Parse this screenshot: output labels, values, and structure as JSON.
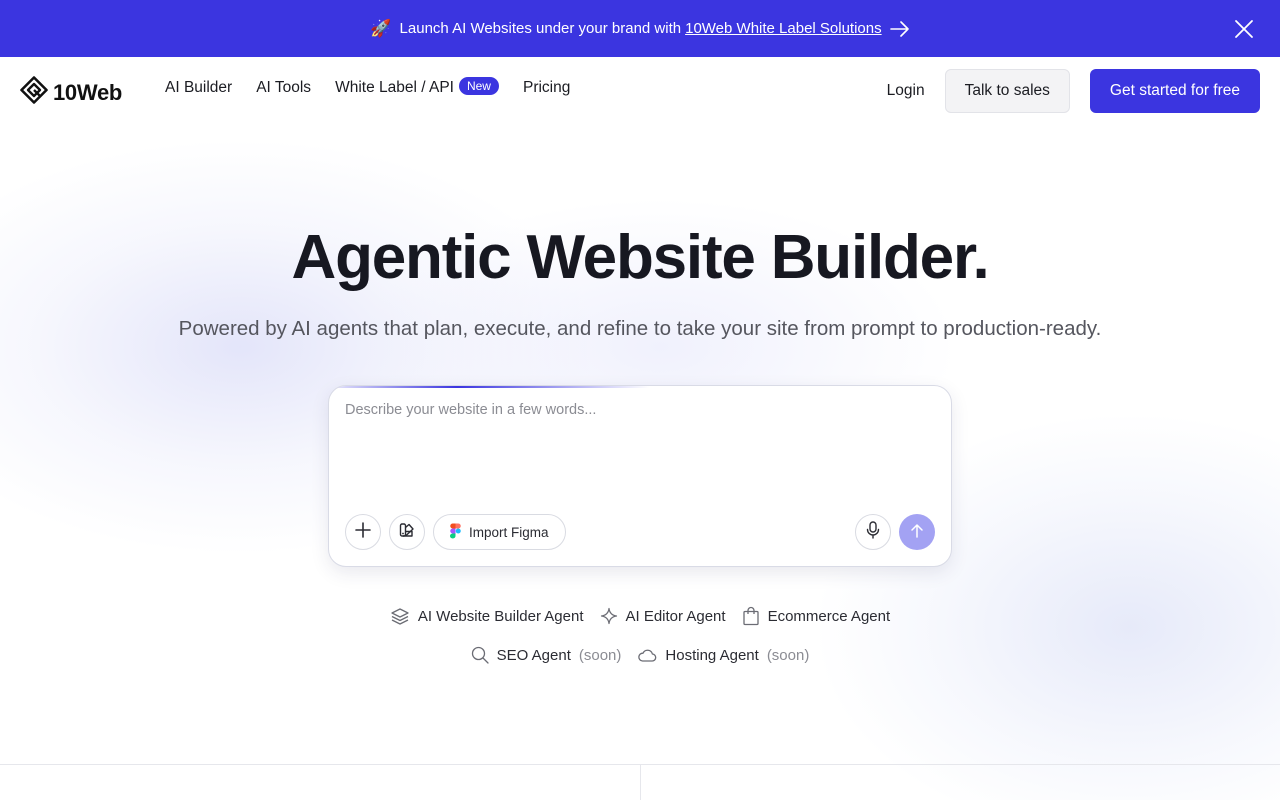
{
  "announcement": {
    "emoji": "🚀",
    "text": "Launch AI Websites under your brand with",
    "link_text": "10Web White Label Solutions"
  },
  "header": {
    "logo_text": "10Web",
    "nav": [
      {
        "label": "AI Builder"
      },
      {
        "label": "AI Tools"
      },
      {
        "label": "White Label / API",
        "badge": "New"
      },
      {
        "label": "Pricing"
      }
    ],
    "login_label": "Login",
    "talk_label": "Talk to sales",
    "start_label": "Get started for free"
  },
  "hero": {
    "title": "Agentic Website Builder.",
    "subtitle": "Powered by AI agents that plan, execute, and refine to take your site from prompt to production-ready."
  },
  "prompt": {
    "placeholder": "Describe your website in a few words...",
    "value": "",
    "figma_label": "Import Figma"
  },
  "agents": {
    "row1": [
      {
        "label": "AI Website Builder Agent",
        "icon": "layers-icon"
      },
      {
        "label": "AI Editor Agent",
        "icon": "sparkle-icon"
      },
      {
        "label": "Ecommerce Agent",
        "icon": "shopping-bag-icon"
      }
    ],
    "row2": [
      {
        "label": "SEO Agent",
        "soon": "(soon)",
        "icon": "search-icon"
      },
      {
        "label": "Hosting Agent",
        "soon": "(soon)",
        "icon": "cloud-icon"
      }
    ]
  },
  "colors": {
    "brand": "#3b35e0",
    "send_button": "#a3a2f3"
  }
}
